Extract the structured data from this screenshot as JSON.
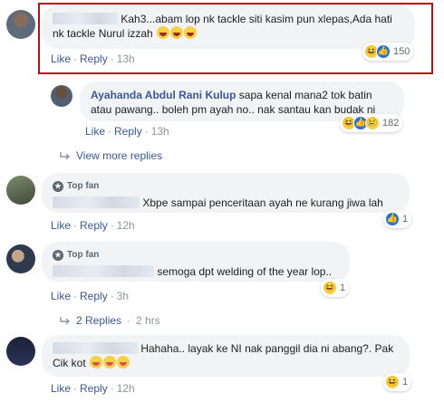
{
  "comments": [
    {
      "text": "Kah3...abam lop nk tackle siti kasim pun xlepas,Ada hati nk tackle Nurul izzah",
      "emoji_count": 3,
      "actions": {
        "like": "Like",
        "reply": "Reply",
        "time": "13h"
      },
      "reaction_count": "150"
    },
    {
      "name": "Ayahanda Abdul Rani Kulup",
      "text": "sapa kenal mana2 tok batin atau pawang.. boleh pm ayah no.. nak santau kan budak ni",
      "actions": {
        "like": "Like",
        "reply": "Reply",
        "time": "13h"
      },
      "reaction_count": "182"
    },
    {
      "badge": "Top fan",
      "text": "Xbpe sampai penceritaan ayah ne kurang jiwa lah",
      "actions": {
        "like": "Like",
        "reply": "Reply",
        "time": "12h"
      },
      "reaction_count": "1"
    },
    {
      "badge": "Top fan",
      "text": "semoga dpt welding of the year lop..",
      "actions": {
        "like": "Like",
        "reply": "Reply",
        "time": "3h"
      },
      "reaction_count": "1"
    },
    {
      "text": "Hahaha.. layak ke NI nak panggil dia ni abang?. Pak Cik kot",
      "actions": {
        "like": "Like",
        "reply": "Reply",
        "time": "12h"
      },
      "reaction_count": "1"
    }
  ],
  "view_more": "View more replies",
  "replies": {
    "label": "2 Replies",
    "time": "2 hrs"
  },
  "separator": "·",
  "icons": [
    "haha-icon",
    "like-icon",
    "sad-icon",
    "reply-arrow-icon",
    "top-fan-icon"
  ]
}
